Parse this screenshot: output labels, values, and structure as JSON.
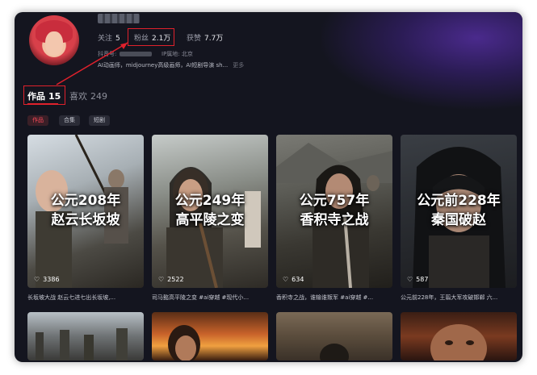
{
  "profile": {
    "follow_label": "关注",
    "follow_count": "5",
    "fans_label": "粉丝",
    "fans_count": "2.1万",
    "likes_label": "获赞",
    "likes_count": "7.7万",
    "douyin_id_label": "抖音号:",
    "ip_label": "IP属地:",
    "ip_value": "北京",
    "bio": "AI动画师，midjourney高级画师，AI短剧导演 sh...",
    "more": "更多"
  },
  "tabs": [
    {
      "label": "作品",
      "count": "15"
    },
    {
      "label": "喜欢",
      "count": "249"
    }
  ],
  "filters": [
    "作品",
    "合集",
    "短剧"
  ],
  "cards": [
    {
      "title_line1": "公元208年",
      "title_line2": "赵云长坂坡",
      "likes": "3386",
      "caption": "长坂坡大战 赵云七进七出长坂坡,..."
    },
    {
      "title_line1": "公元249年",
      "title_line2": "高平陵之变",
      "likes": "2522",
      "caption": "司马懿高平陵之变 #ai穿越 #现代小..."
    },
    {
      "title_line1": "公元757年",
      "title_line2": "香积寺之战",
      "likes": "634",
      "caption": "香积寺之战，谁输谁叛军 #ai穿越 #..."
    },
    {
      "title_line1": "公元前228年",
      "title_line2": "秦国破赵",
      "likes": "587",
      "caption": "公元前228年，王翦大军攻破邯郸 六..."
    }
  ],
  "colors": {
    "accent": "#e0212c",
    "background": "#14151f"
  }
}
